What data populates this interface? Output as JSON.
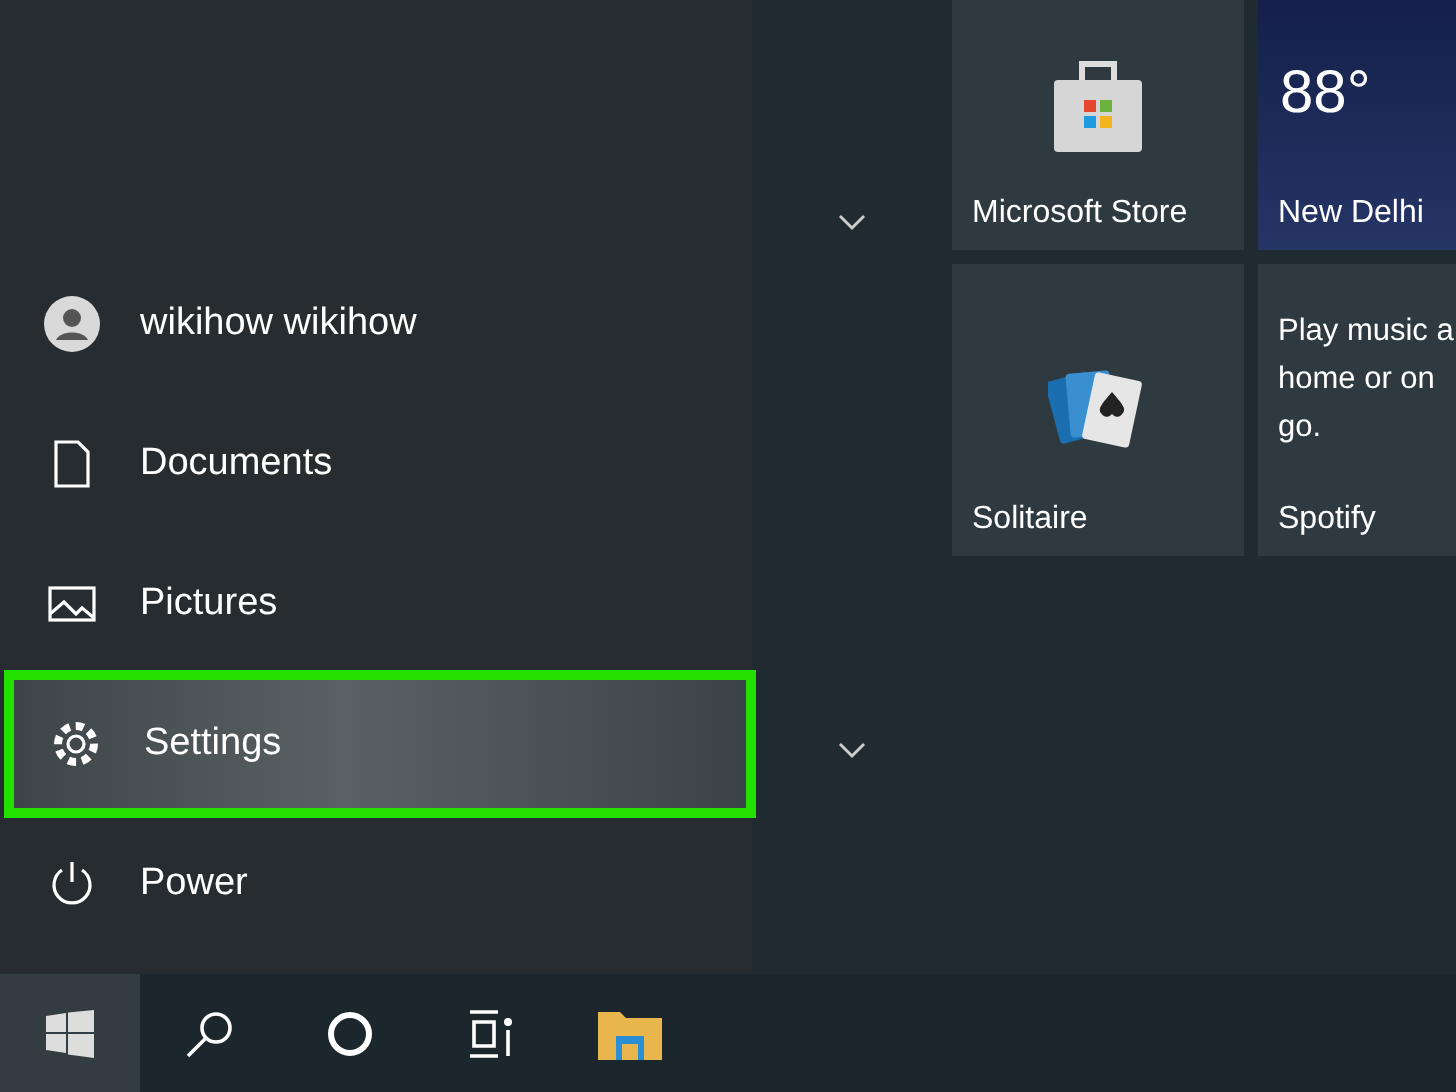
{
  "menu_items": [
    {
      "kind": "user",
      "label": "wikihow wikihow",
      "selected": false
    },
    {
      "kind": "documents",
      "label": "Documents",
      "selected": false
    },
    {
      "kind": "pictures",
      "label": "Pictures",
      "selected": false
    },
    {
      "kind": "settings",
      "label": "Settings",
      "selected": true
    },
    {
      "kind": "power",
      "label": "Power",
      "selected": false
    }
  ],
  "groups": [
    {
      "expanded": false
    },
    {
      "expanded": false
    }
  ],
  "tiles": [
    {
      "kind": "store",
      "label": "Microsoft Store"
    },
    {
      "kind": "weather",
      "label": "New Delhi",
      "temperature": "88°"
    },
    {
      "kind": "solitaire",
      "label": "Solitaire"
    },
    {
      "kind": "spotify",
      "label": "Spotify",
      "lines": [
        "Play music a",
        "home or on",
        "go."
      ]
    }
  ],
  "taskbar": [
    {
      "kind": "start",
      "selected": true
    },
    {
      "kind": "search",
      "selected": false
    },
    {
      "kind": "cortana",
      "selected": false
    },
    {
      "kind": "taskview",
      "selected": false
    },
    {
      "kind": "explorer",
      "selected": false
    }
  ]
}
